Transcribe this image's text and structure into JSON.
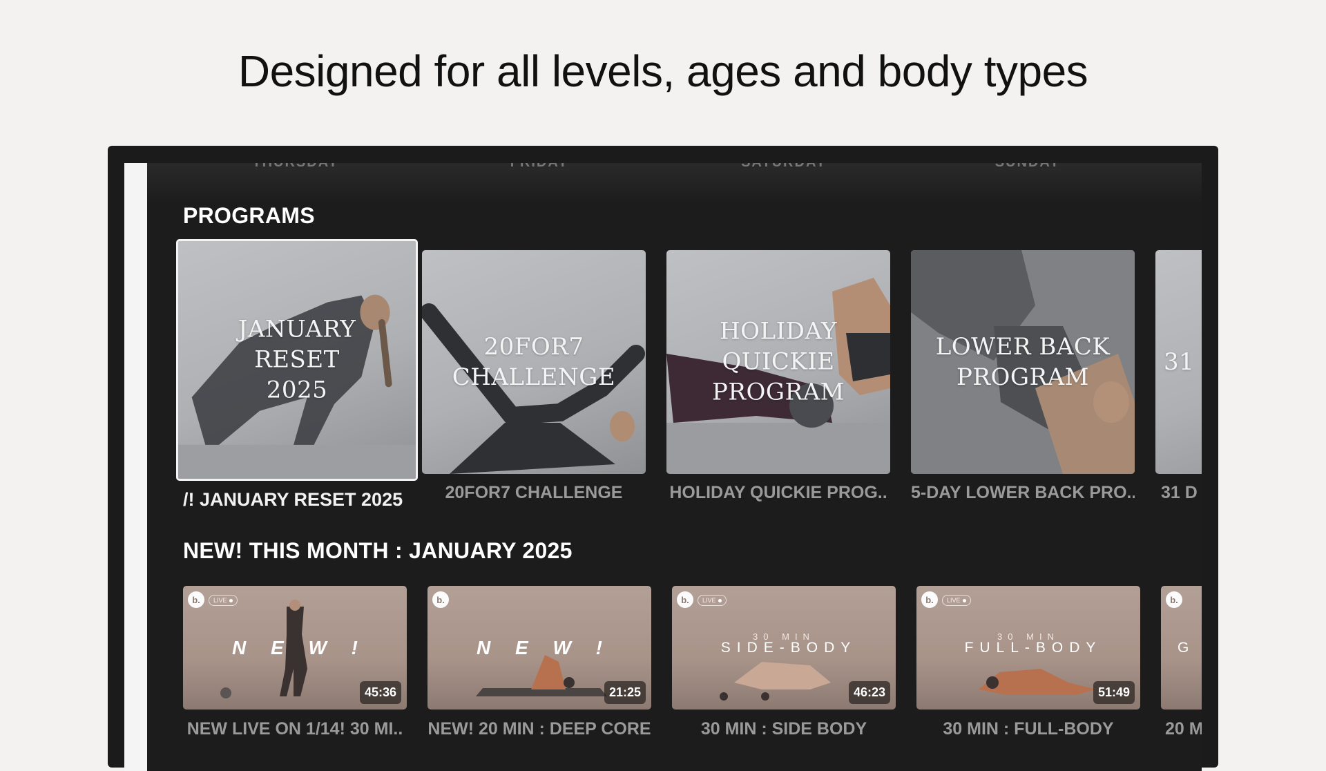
{
  "headline": "Designed for all levels, ages and body types",
  "day_labels": [
    "THURSDAY",
    "FRIDAY",
    "SATURDAY",
    "SUNDAY"
  ],
  "programs": {
    "title": "PROGRAMS",
    "items": [
      {
        "overlay": "JANUARY\nRESET\n2025",
        "caption": "/! JANUARY RESET 2025",
        "focused": true
      },
      {
        "overlay": "20FOR7\nCHALLENGE",
        "caption": "20FOR7 CHALLENGE",
        "focused": false
      },
      {
        "overlay": "HOLIDAY QUICKIE\nPROGRAM",
        "caption": "HOLIDAY QUICKIE PROG..",
        "focused": false
      },
      {
        "overlay": "LOWER BACK\nPROGRAM",
        "caption": "5-DAY LOWER BACK PRO..",
        "focused": false
      },
      {
        "overlay": "31",
        "caption": "31 D",
        "focused": false
      }
    ]
  },
  "new_this_month": {
    "title": "NEW! THIS MONTH : JANUARY 2025",
    "items": [
      {
        "logo": "b.",
        "live": "LIVE",
        "subtitle": "",
        "title": "N E W !",
        "duration": "45:36",
        "caption": "NEW LIVE ON 1/14! 30 MI.."
      },
      {
        "logo": "b.",
        "live": "",
        "subtitle": "",
        "title": "N E W !",
        "duration": "21:25",
        "caption": "NEW! 20 MIN : DEEP CORE"
      },
      {
        "logo": "b.",
        "live": "LIVE",
        "subtitle": "30 MIN",
        "title": "SIDE-BODY",
        "duration": "46:23",
        "caption": "30 MIN : SIDE BODY"
      },
      {
        "logo": "b.",
        "live": "LIVE",
        "subtitle": "30 MIN",
        "title": "FULL-BODY",
        "duration": "51:49",
        "caption": "30 MIN : FULL-BODY"
      },
      {
        "logo": "b.",
        "live": "",
        "subtitle": "",
        "title": "G L",
        "duration": "",
        "caption": "20 M"
      }
    ]
  }
}
